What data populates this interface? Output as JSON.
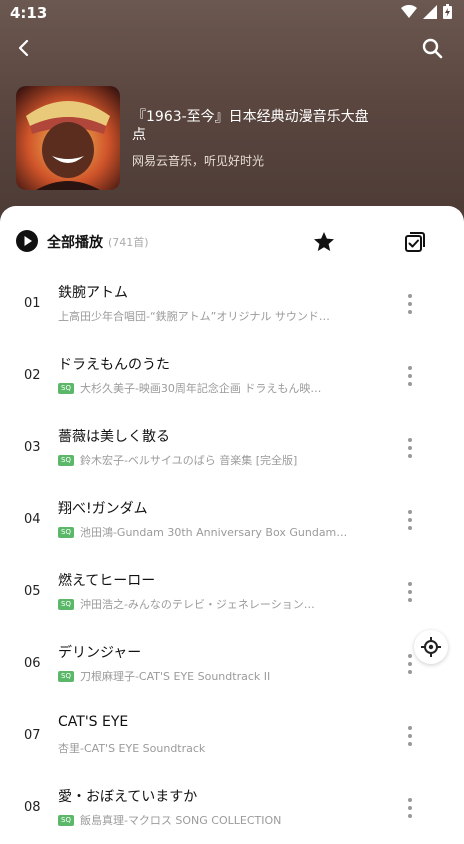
{
  "status_bar": {
    "time": "4:13"
  },
  "playlist": {
    "title": "『1963-至今』日本经典动漫音乐大盘点",
    "subtitle": "网易云音乐，听见好时光"
  },
  "toolbar": {
    "play_all": "全部播放",
    "count": "(741首)"
  },
  "sq_label": "SQ",
  "songs": [
    {
      "num": "01",
      "title": "鉄腕アトム",
      "artist": "上高田少年合唱団-“鉄腕アトム”オリジナル サウンド…",
      "sq": false
    },
    {
      "num": "02",
      "title": "ドラえもんのうた",
      "artist": "大杉久美子-映画30周年記念企画 ドラえもん映…",
      "sq": true
    },
    {
      "num": "03",
      "title": "薔薇は美しく散る",
      "artist": "鈴木宏子-ベルサイユのばら 音楽集 [完全版]",
      "sq": true
    },
    {
      "num": "04",
      "title": "翔べ!ガンダム",
      "artist": "池田鴻-Gundam 30th Anniversary Box Gundam…",
      "sq": true
    },
    {
      "num": "05",
      "title": "燃えてヒーロー",
      "artist": "沖田浩之-みんなのテレビ・ジェネレーション…",
      "sq": true
    },
    {
      "num": "06",
      "title": "デリンジャー",
      "artist": "刀根麻理子-CAT'S EYE Soundtrack II",
      "sq": true
    },
    {
      "num": "07",
      "title": "CAT'S EYE",
      "artist": "杏里-CAT'S EYE Soundtrack",
      "sq": false
    },
    {
      "num": "08",
      "title": "愛・おぼえていますか",
      "artist": "飯島真理-マクロス SONG COLLECTION",
      "sq": true
    }
  ]
}
